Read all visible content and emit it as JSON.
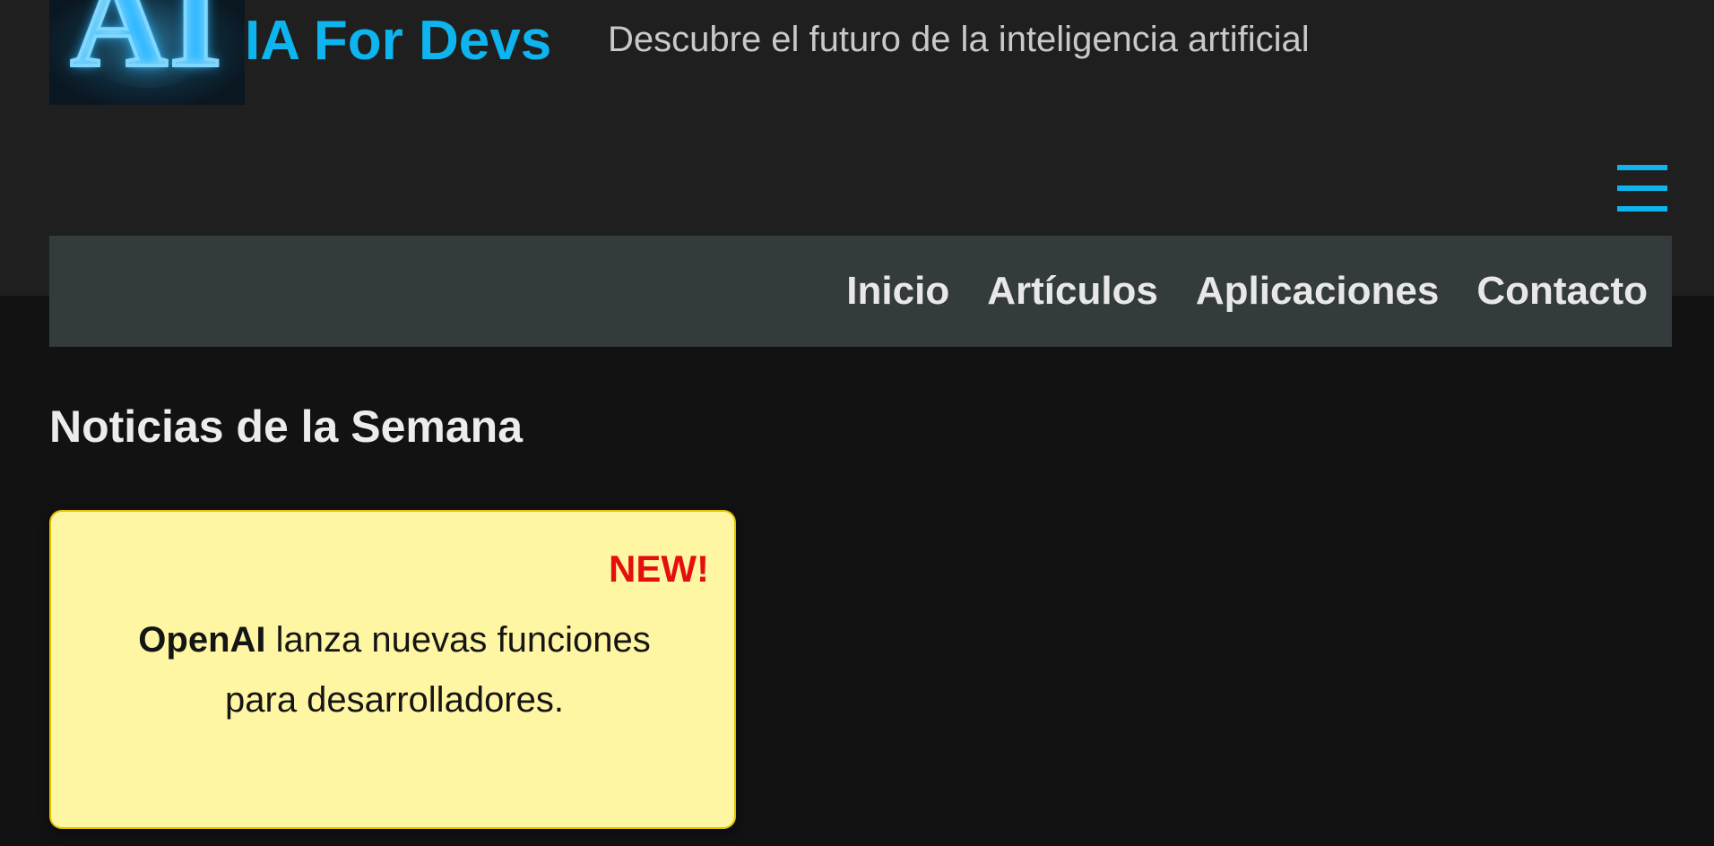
{
  "header": {
    "logo": {
      "text": "AI",
      "icon": "ai-logo-icon"
    },
    "site_title": "IA For Devs",
    "tagline": "Descubre el futuro de la inteligencia artificial",
    "menu_toggle": {
      "icon": "hamburger-menu-icon",
      "glyph": "☰"
    }
  },
  "nav": {
    "items": [
      {
        "label": "Inicio"
      },
      {
        "label": "Artículos"
      },
      {
        "label": "Aplicaciones"
      },
      {
        "label": "Contacto"
      }
    ]
  },
  "main": {
    "section_title": "Noticias de la Semana",
    "news_card": {
      "badge": "NEW!",
      "headline_bold": "OpenAI",
      "headline_rest": " lanza nuevas funciones para desarrolladores."
    }
  },
  "colors": {
    "accent": "#0db4ee",
    "page_background": "#121212",
    "header_background": "#1f1f1f",
    "nav_background": "#343b3c",
    "card_background": "#fff6a3",
    "badge": "#e40f0f"
  }
}
